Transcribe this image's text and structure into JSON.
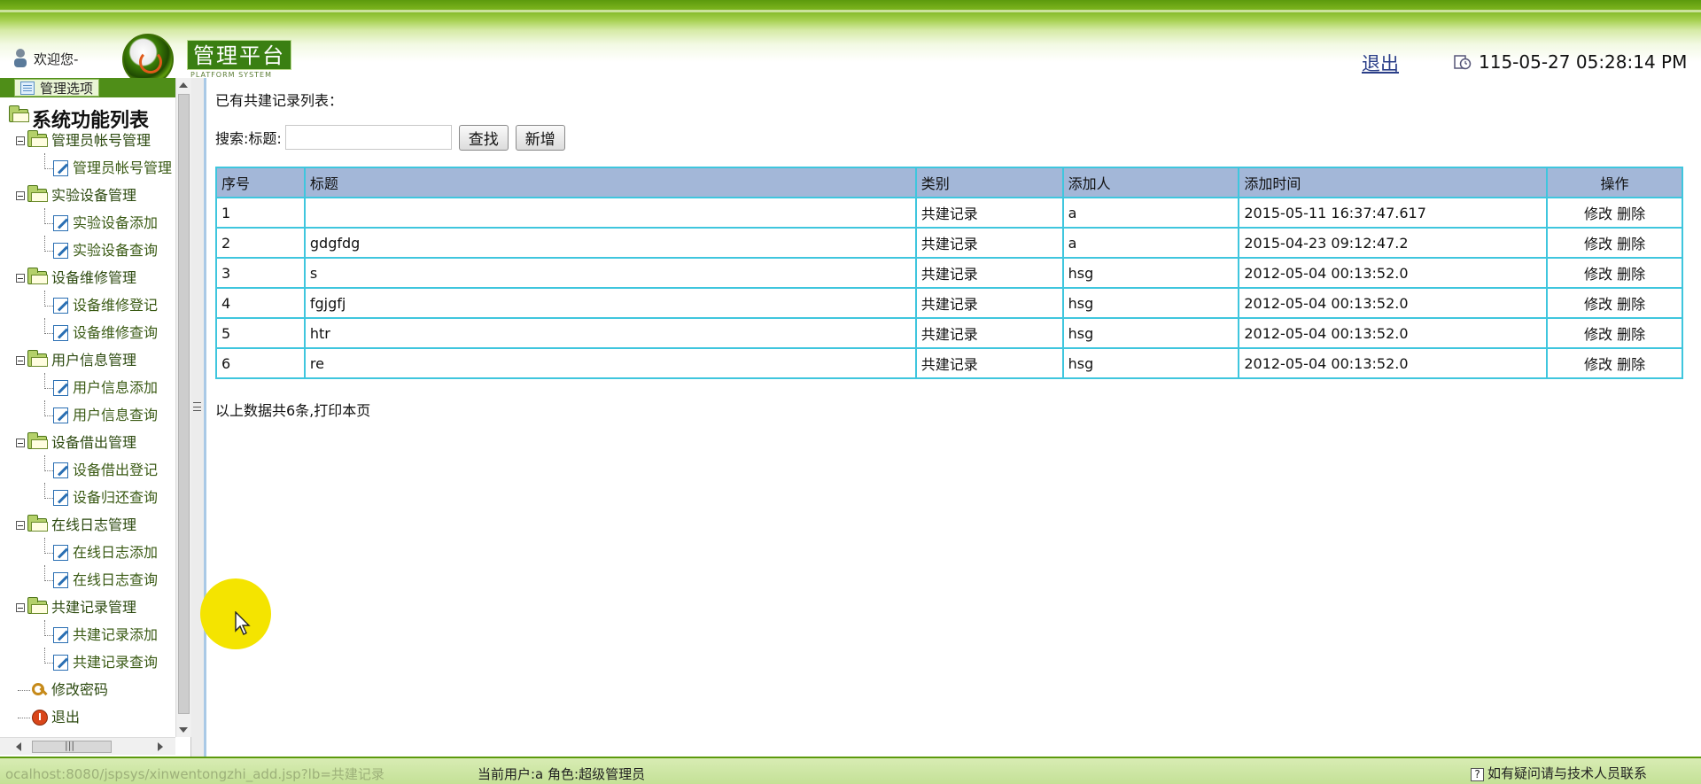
{
  "header": {
    "welcome": "欢迎您-",
    "logo_title": "管理平台",
    "logo_sub": "PLATFORM SYSTEM",
    "logout": "退出",
    "datetime": "115-05-27 05:28:14 PM"
  },
  "sidebar": {
    "tab_label": "管理选项",
    "root_label": "系统功能列表",
    "groups": [
      {
        "label": "管理员帐号管理",
        "items": [
          "管理员帐号管理"
        ]
      },
      {
        "label": "实验设备管理",
        "items": [
          "实验设备添加",
          "实验设备查询"
        ]
      },
      {
        "label": "设备维修管理",
        "items": [
          "设备维修登记",
          "设备维修查询"
        ]
      },
      {
        "label": "用户信息管理",
        "items": [
          "用户信息添加",
          "用户信息查询"
        ]
      },
      {
        "label": "设备借出管理",
        "items": [
          "设备借出登记",
          "设备归还查询"
        ]
      },
      {
        "label": "在线日志管理",
        "items": [
          "在线日志添加",
          "在线日志查询"
        ]
      },
      {
        "label": "共建记录管理",
        "items": [
          "共建记录添加",
          "共建记录查询"
        ]
      }
    ],
    "change_password": "修改密码",
    "logout": "退出"
  },
  "content": {
    "list_title": "已有共建记录列表：",
    "search_label": "搜索:标题:",
    "search_value": "",
    "search_button": "查找",
    "add_button": "新增",
    "columns": [
      "序号",
      "标题",
      "类别",
      "添加人",
      "添加时间",
      "操作"
    ],
    "rows": [
      {
        "id": "1",
        "title": "",
        "category": "共建记录",
        "adder": "a",
        "time": "2015-05-11 16:37:47.617"
      },
      {
        "id": "2",
        "title": "gdgfdg",
        "category": "共建记录",
        "adder": "a",
        "time": "2015-04-23 09:12:47.2"
      },
      {
        "id": "3",
        "title": "s",
        "category": "共建记录",
        "adder": "hsg",
        "time": "2012-05-04 00:13:52.0"
      },
      {
        "id": "4",
        "title": "fgjgfj",
        "category": "共建记录",
        "adder": "hsg",
        "time": "2012-05-04 00:13:52.0"
      },
      {
        "id": "5",
        "title": "htr",
        "category": "共建记录",
        "adder": "hsg",
        "time": "2012-05-04 00:13:52.0"
      },
      {
        "id": "6",
        "title": "re",
        "category": "共建记录",
        "adder": "hsg",
        "time": "2012-05-04 00:13:52.0"
      }
    ],
    "edit_label": "修改",
    "delete_label": "删除",
    "footer_note": "以上数据共6条,打印本页"
  },
  "statusbar": {
    "url": "ocalhost:8080/jspsys/xinwentongzhi_add.jsp?lb=共建记录",
    "user_info": "当前用户:a  角色:超级管理员",
    "help": "如有疑问请与技术人员联系"
  },
  "colors": {
    "header_green": "#5c9a0d",
    "table_border": "#3fc6de",
    "table_header_bg": "#a3b7d8",
    "link_blue": "#2a3e88"
  }
}
